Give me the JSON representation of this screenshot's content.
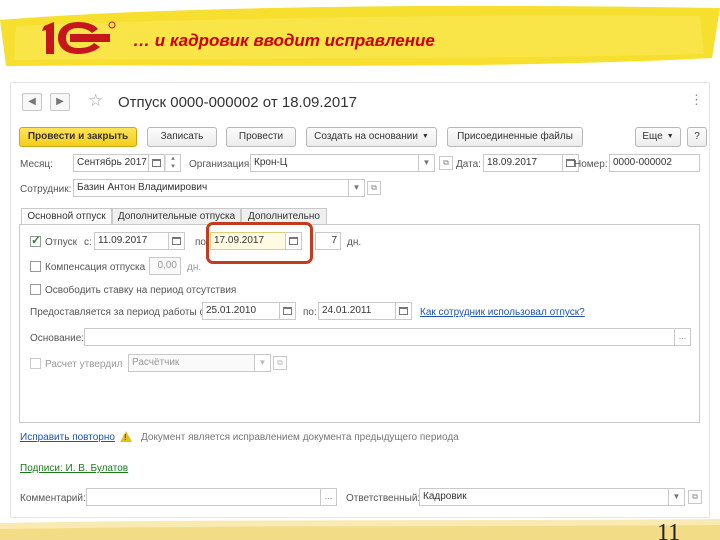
{
  "slide": {
    "title": "… и кадровик вводит исправление",
    "page_number": "11"
  },
  "window": {
    "title": "Отпуск 0000-000002 от 18.09.2017",
    "nav_back_icon": "arrow-left-icon",
    "nav_forward_icon": "arrow-right-icon",
    "favorite_icon": "star-icon",
    "more_icon": "vertical-dots-icon"
  },
  "toolbar": {
    "post_and_close": "Провести и закрыть",
    "save": "Записать",
    "post": "Провести",
    "create_based_on": "Создать на основании",
    "attached_files": "Присоединенные файлы",
    "more": "Еще",
    "help": "?"
  },
  "header_fields": {
    "month_label": "Месяц:",
    "month_value": "Сентябрь 2017",
    "organization_label": "Организация:",
    "organization_value": "Крон-Ц",
    "date_label": "Дата:",
    "date_value": "18.09.2017",
    "number_label": "Номер:",
    "number_value": "0000-000002",
    "employee_label": "Сотрудник:",
    "employee_value": "Базин Антон Владимирович"
  },
  "tabs": [
    {
      "label": "Основной отпуск",
      "active": true
    },
    {
      "label": "Дополнительные отпуска",
      "active": false
    },
    {
      "label": "Дополнительно",
      "active": false
    }
  ],
  "main_leave": {
    "leave_label": "Отпуск",
    "leave_checked": true,
    "from_label": "с:",
    "from_value": "11.09.2017",
    "to_label": "по",
    "to_value": "17.09.2017",
    "days_value": "7",
    "days_unit": "дн.",
    "compensation_label": "Компенсация отпуска",
    "compensation_checked": false,
    "compensation_value": "0,00",
    "compensation_unit": "дн.",
    "release_rate_label": "Освободить ставку на период отсутствия",
    "release_rate_checked": false,
    "period_label": "Предоставляется за период работы с:",
    "period_from": "25.01.2010",
    "period_to_label": "по:",
    "period_to": "24.01.2011",
    "how_used_link": "Как сотрудник использовал отпуск?",
    "basis_label": "Основание:",
    "basis_value": "",
    "approved_label": "Расчет утвердил",
    "approved_checked": false,
    "approved_value": "Расчётчик"
  },
  "footer": {
    "fix_again_link": "Исправить повторно",
    "correction_note": "Документ является исправлением документа предыдущего периода",
    "signatures_link": "Подписи: И. В. Булатов",
    "comment_label": "Комментарий:",
    "comment_value": "",
    "responsible_label": "Ответственный:",
    "responsible_value": "Кадровик"
  },
  "colors": {
    "title_red": "#cc0000",
    "primary_button": "#f4cd1a",
    "highlight_border": "#c33b1e",
    "link_blue": "#1f54a8",
    "link_green": "#1a7a1a"
  }
}
